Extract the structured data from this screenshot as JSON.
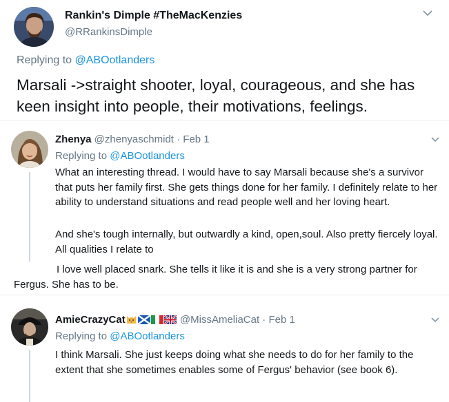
{
  "main_tweet": {
    "author_name": "Rankin's Dimple #TheMacKenzies",
    "author_handle": "@RRankinsDimple",
    "replying_prefix": "Replying to ",
    "replying_to": "@ABOotlanders",
    "text": "Marsali ->straight shooter, loyal, courageous, and she has keen insight into people, their motivations, feelings."
  },
  "replies": [
    {
      "author_name": "Zhenya",
      "meta": " @zhenyaschmidt · Feb 1",
      "replying_prefix": "Replying to ",
      "replying_to": "@ABOotlanders",
      "paragraphs": [
        "What an interesting thread. I would have to say Marsali because she's a survivor that puts her family first.  She gets things done for her family. I definitely relate to her ability to understand situations and read people well and her loving heart.",
        "And she's tough internally, but outwardly a kind, open,soul. Also pretty fiercely loyal. All qualities I relate to",
        "I love well placed snark. She tells it like it is and she is a very strong partner for Fergus. She has to be."
      ]
    },
    {
      "author_name": "AmieCrazyCat",
      "emojis": [
        "cat-face-emoji",
        "scotland-flag-emoji",
        "italy-flag-emoji",
        "uk-flag-emoji"
      ],
      "meta": " @MissAmeliaCat · Feb 1",
      "replying_prefix": "Replying to ",
      "replying_to": "@ABOotlanders",
      "paragraphs": [
        "I think Marsali. She just keeps doing what she needs to do for her family to the extent that she sometimes enables some of Fergus' behavior (see book 6)."
      ]
    }
  ],
  "colors": {
    "link": "#1b95e0",
    "secondary_text": "#657786",
    "primary_text": "#14171a",
    "divider": "#e6ecf0"
  }
}
